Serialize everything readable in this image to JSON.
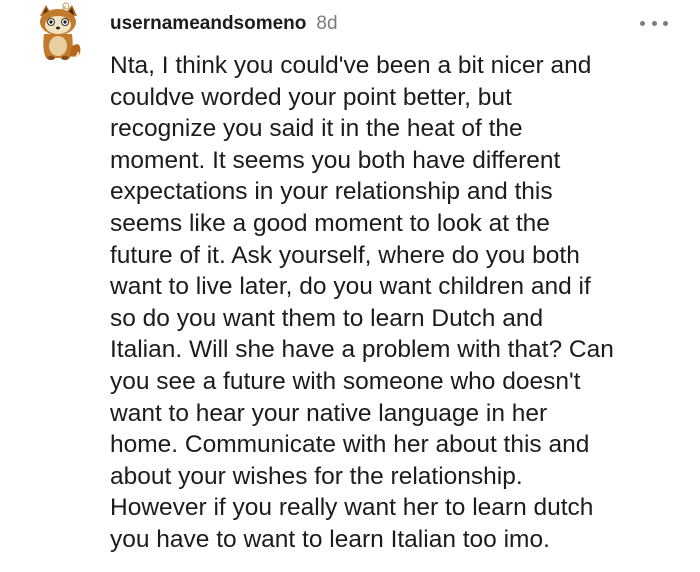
{
  "comment": {
    "username": "usernameandsomeno",
    "age": "8d",
    "avatar_icon": "fox-avatar-icon",
    "more_icon": "more-options-icon",
    "body_lines": [
      "Nta, I think you could've been a bit nicer and",
      "couldve worded your point better, but",
      "recognize you said it in the heat of the",
      "moment. It seems you both have different",
      "expectations in your relationship and this",
      "seems like a good moment to look at the",
      "future of it. Ask yourself, where do you both",
      "want to live later, do you want children and if",
      "so do you want them to learn Dutch and",
      "Italian. Will she have a problem with that? Can",
      "you see a future with someone who doesn't",
      "want to hear your native language in her",
      "home. Communicate with her about this and",
      "about your wishes for the relationship.",
      "However if you really want her to learn dutch",
      "you have to want to learn Italian too imo."
    ]
  }
}
